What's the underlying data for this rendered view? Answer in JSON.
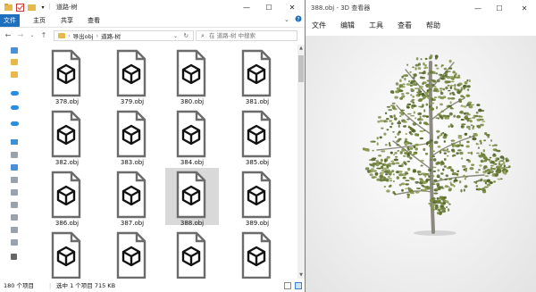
{
  "explorer": {
    "title": "道路-树",
    "ribbon_tabs": [
      "文件",
      "主页",
      "共享",
      "查看"
    ],
    "breadcrumb": [
      "导出obj",
      "道路-树"
    ],
    "search_placeholder": "在 道路-树 中搜索",
    "files": [
      "378.obj",
      "379.obj",
      "380.obj",
      "381.obj",
      "382.obj",
      "383.obj",
      "384.obj",
      "385.obj",
      "386.obj",
      "387.obj",
      "388.obj",
      "389.obj",
      "",
      "",
      "",
      ""
    ],
    "selected_file": "388.obj",
    "status": {
      "item_count": "180 个项目",
      "selection": "选中 1 个项目  715 KB"
    }
  },
  "viewer": {
    "title": "388.obj - 3D 查看器",
    "menu": [
      "文件",
      "编辑",
      "工具",
      "查看",
      "帮助"
    ]
  },
  "colors": {
    "accent": "#1f6fbf",
    "selection_bg": "#d9d9d9",
    "foliage": "#6e7f3a",
    "trunk": "#8c8a80"
  }
}
